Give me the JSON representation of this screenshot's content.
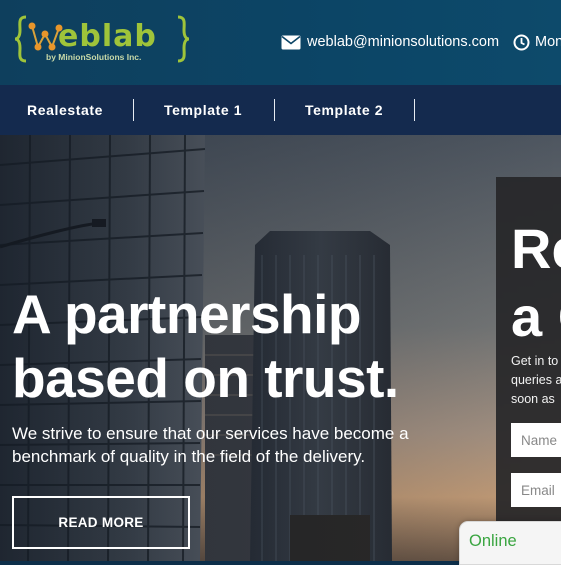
{
  "brand": {
    "logo_text": "WebLab",
    "logo_tagline": "by MinionSolutions Inc.",
    "logo_color": "#9fc43a"
  },
  "contact": {
    "email": "weblab@minionsolutions.com",
    "hours_partial": "Mon",
    "email_icon": "envelope-icon",
    "hours_icon": "clock-icon"
  },
  "nav": {
    "items": [
      {
        "label": "Realestate"
      },
      {
        "label": "Template 1"
      },
      {
        "label": "Template 2"
      }
    ]
  },
  "hero": {
    "title_line1": "A partnership",
    "title_line2": "based on trust.",
    "description": "We strive to ensure that our services have become a benchmark of quality in the field of the delivery.",
    "cta_label": "READ MORE"
  },
  "form_panel": {
    "title_line1": "Re",
    "title_line2": "a C",
    "desc_line1": "Get in to",
    "desc_line2": "queries a",
    "desc_line3": "soon as",
    "name_placeholder": "Name",
    "email_placeholder": "Email"
  },
  "chat_widget": {
    "status": "Online",
    "status_color": "#3aa541"
  },
  "colors": {
    "header_bg": "#0e3f5d",
    "nav_bg": "#142a4e",
    "panel_bg": "#262628"
  }
}
